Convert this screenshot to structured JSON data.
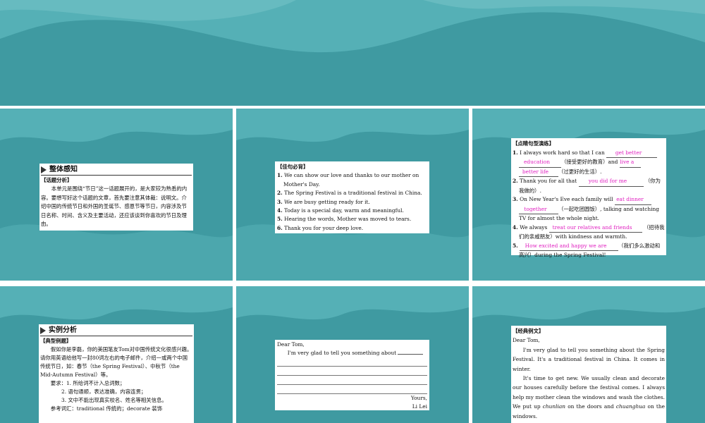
{
  "colors": {
    "teal": "#3f9aa1",
    "wave": "#55b0b6",
    "light_wave": "#7cc6ca",
    "fill_text": "#e020c0"
  },
  "slide1": {
    "section_title": "整体感知",
    "topic_header": "【话题分析】",
    "topic_text": "本单元是围绕“节日”这一话题展开的，是大家较为熟悉的内容。要想写好这个话题的文章，首先要注意其体裁：说明文。介绍中国的传统节日和外国的圣诞节、感恩节等节日，内容涉及节日名称、时间、含义及主要活动，还应该谈到你喜欢的节日及理由。"
  },
  "slide2": {
    "header": "【佳句必背】",
    "sentences": [
      {
        "num": "1.",
        "text": "We can show our love and thanks to our mother on Mother's Day."
      },
      {
        "num": "2.",
        "text": "The Spring Festival is a traditional festival in China."
      },
      {
        "num": "3.",
        "text": "We are busy getting ready for it."
      },
      {
        "num": "4.",
        "text": "Today is a special day, warm and meaningful."
      },
      {
        "num": "5.",
        "text": "Hearing the words, Mother was moved to tears."
      },
      {
        "num": "6.",
        "text": "Thank you for your deep love."
      }
    ]
  },
  "slide3": {
    "header": "【点睛句型演练】",
    "i1": {
      "num": "1.",
      "a": "I always work hard so that I can",
      "f1": "get better",
      "f2": "education",
      "b": "（接受更好的教育）and",
      "f3": "live a",
      "f4": "better life",
      "c": "（过更好的生活）."
    },
    "i2": {
      "num": "2.",
      "a": "Thank you for all that",
      "f1": "you did for me",
      "b": "（你为我做的）."
    },
    "i3": {
      "num": "3.",
      "a": "On New Year's Eve each family will",
      "f1": "eat dinner",
      "f2": "together",
      "b": "（一起吃团圆饭）, talking and watching TV for almost the whole night."
    },
    "i4": {
      "num": "4.",
      "a": "We always",
      "f1": "treat our relatives and friends",
      "b": "（招待我们的亲戚朋友）with kindness and warmth."
    },
    "i5": {
      "num": "5.",
      "f1": "How excited and happy we are",
      "b": "（我们多么激动和高兴）during the Spring Festival!"
    }
  },
  "slide4": {
    "section_title": "实例分析",
    "header": "【典型例题】",
    "para": "假如你是李磊，你的美国笔友Tom对中国传统文化很感兴趣。请你用英语给他写一封80词左右的电子邮件，介绍一或两个中国传统节日，如：春节（the Spring Festival）、中秋节（the Mid-Autumn Festival）等。",
    "req_intro": "要求：1. 所给词不计入总词数；",
    "req2": "2. 语句通顺，表达准确，内容连贯；",
    "req3": "3. 文中不能出现真实校名、姓名等相关信息。",
    "vocab": "参考词汇：traditional 传统的；decorate 装饰"
  },
  "slide5": {
    "greeting": "Dear Tom,",
    "opening": "I'm very glad to tell you something about",
    "closing": "Yours,",
    "signature": "Li Lei"
  },
  "slide6": {
    "header": "【经典例文】",
    "greeting": "Dear Tom,",
    "p1": "I'm very glad to tell you something about the Spring Festival. It's a traditional festival in China. It comes in winter.",
    "p2_a": "It's time to get new. We usually clean and decorate our houses carefully before the festival comes. I always help my mother clean the windows and wash the clothes. We put up",
    "chunlian": "chunlian",
    "p2_b": "on the doors and",
    "chuanghua": "chuanghua",
    "p2_c": "on the windows."
  }
}
